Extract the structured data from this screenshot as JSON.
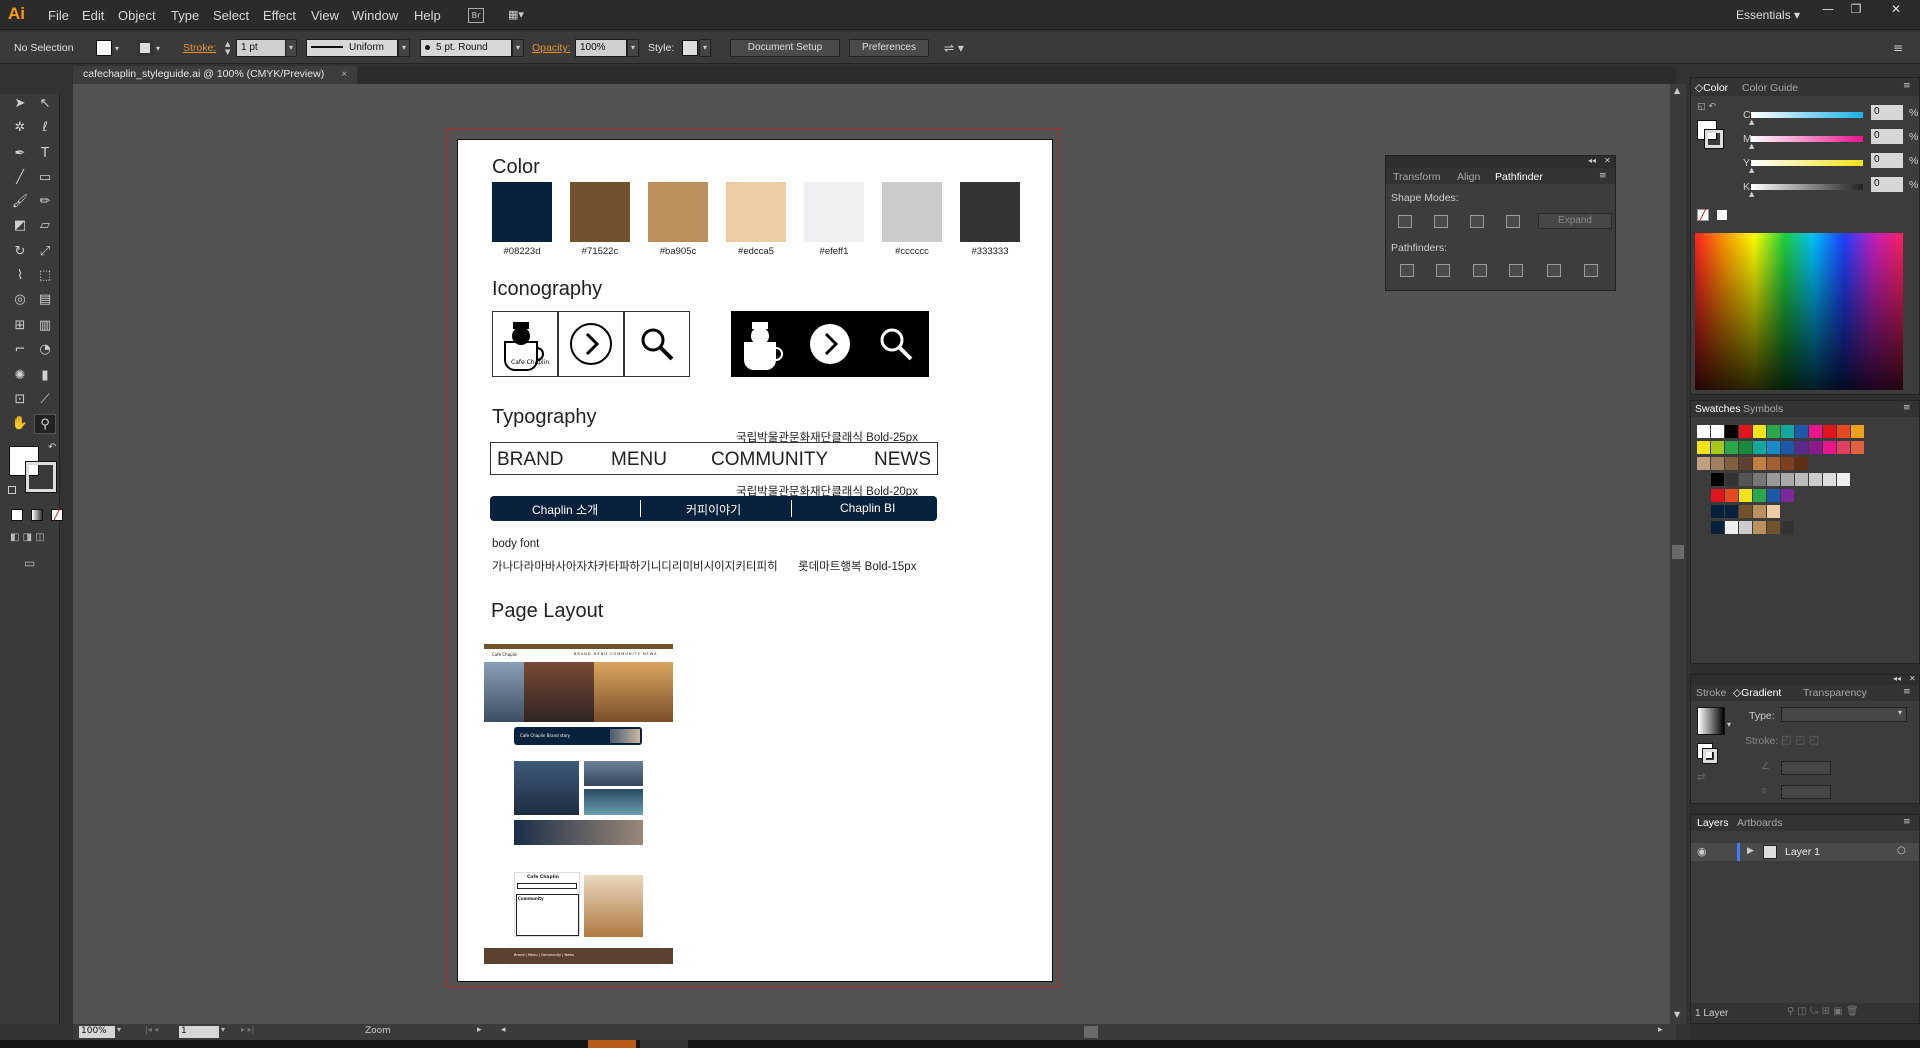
{
  "app": {
    "logo": "Ai",
    "menus": [
      "File",
      "Edit",
      "Object",
      "Type",
      "Select",
      "Effect",
      "View",
      "Window",
      "Help"
    ],
    "workspace": "Essentials",
    "window_buttons": [
      "—",
      "❐",
      "✕"
    ]
  },
  "control_bar": {
    "selection": "No Selection",
    "stroke_label": "Stroke:",
    "stroke_value": "1 pt",
    "stroke_profile": "Uniform",
    "brush": "5 pt. Round",
    "opacity_label": "Opacity:",
    "opacity_value": "100%",
    "style_label": "Style:",
    "document_setup": "Document Setup",
    "preferences": "Preferences"
  },
  "document": {
    "tab_title": "cafechaplin_styleguide.ai @ 100% (CMYK/Preview)",
    "close": "×"
  },
  "styleguide": {
    "color_heading": "Color",
    "colors": [
      {
        "hex": "#08223d",
        "label": "#08223d"
      },
      {
        "hex": "#71522c",
        "label": "#71522c"
      },
      {
        "hex": "#ba905c",
        "label": "#ba905c"
      },
      {
        "hex": "#edcca5",
        "label": "#edcca5"
      },
      {
        "hex": "#efeff1",
        "label": "#efeff1"
      },
      {
        "hex": "#cccccc",
        "label": "#cccccc"
      },
      {
        "hex": "#333333",
        "label": "#333333"
      }
    ],
    "iconography_heading": "Iconography",
    "logo_text": "Cafe Chaplin",
    "typography_heading": "Typography",
    "font_note_1": "국립박물관문화재단클래식 Bold-25px",
    "nav_words": [
      "BRAND",
      "MENU",
      "COMMUNITY",
      "NEWS"
    ],
    "font_note_2": "국립박물관문화재단클래식 Bold-20px",
    "subnav_words": [
      "Chaplin 소개",
      "커피이야기",
      "Chaplin BI"
    ],
    "body_font_label": "body font",
    "body_font_sample": "가나다라마바사아자차카타파하기니디리미비시이지키티피히",
    "body_font_note": "롯데마트행복 Bold-15px",
    "page_layout_heading": "Page Layout",
    "thumb_nav": [
      "BRAND",
      "MENU",
      "COMMUNITY",
      "NEWS"
    ],
    "thumb_logo": "Cafe Chaplin",
    "thumb_banner": "Cafe Chaplin Brand story",
    "thumb_community": "Community",
    "thumb_footer": "Brand  |  Menu  |  Community  |  News"
  },
  "status_bar": {
    "zoom": "100%",
    "artboard": "1",
    "tool": "Zoom"
  },
  "color_panel": {
    "tabs": [
      "Color",
      "Color Guide"
    ],
    "channels": [
      {
        "name": "C",
        "value": "0",
        "color": "#1ab0e8"
      },
      {
        "name": "M",
        "value": "0",
        "color": "#e8168c"
      },
      {
        "name": "Y",
        "value": "0",
        "color": "#f4e21a"
      },
      {
        "name": "K",
        "value": "0",
        "color": "#333333"
      }
    ],
    "pct": "%"
  },
  "pathfinder_panel": {
    "tabs": [
      "Transform",
      "Align",
      "Pathfinder"
    ],
    "shape_modes": "Shape Modes:",
    "expand": "Expand",
    "pathfinders": "Pathfinders:"
  },
  "swatches_panel": {
    "tabs": [
      "Swatches",
      "Symbols"
    ]
  },
  "gradient_panel": {
    "tabs": [
      "Stroke",
      "Gradient",
      "Transparency"
    ],
    "type_label": "Type:",
    "stroke_label": "Stroke:"
  },
  "layers_panel": {
    "tabs": [
      "Layers",
      "Artboards"
    ],
    "layer_name": "Layer 1",
    "footer": "1 Layer"
  }
}
